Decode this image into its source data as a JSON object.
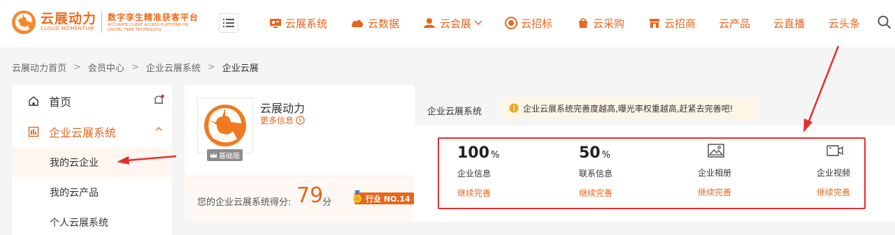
{
  "header": {
    "logo_cn": "云展动力",
    "logo_en": "CLOUD MOMENTUM",
    "slogan_cn": "数字孪生精准获客平台",
    "slogan_en": "ACCURATE CLIENT ACCESS PLATFORM ON DIGITAL TWIN TECHNOLOGY",
    "nav": [
      {
        "label": "云展系统",
        "icon": "exhibit-system-icon"
      },
      {
        "label": "云数据",
        "icon": "cloud-data-icon"
      },
      {
        "label": "云会展",
        "icon": "cloud-expo-icon"
      },
      {
        "label": "云招标",
        "icon": "cloud-bidding-icon"
      },
      {
        "label": "云采购",
        "icon": "cloud-purchase-icon"
      },
      {
        "label": "云招商",
        "icon": "cloud-investment-icon"
      },
      {
        "label": "云产品"
      },
      {
        "label": "云直播"
      },
      {
        "label": "云头条"
      }
    ],
    "accent": "#e8661a"
  },
  "breadcrumb": [
    "云展动力首页",
    "会员中心",
    "企业云展系统",
    "企业云展"
  ],
  "sidebar": {
    "home": "首页",
    "group": "企业云展系统",
    "items": [
      "我的云企业",
      "我的云产品",
      "个人云展系统"
    ],
    "active_index": 0
  },
  "profile": {
    "company_name": "云展动力",
    "more_info": "更多信息",
    "edition_badge": "基础版",
    "score_label": "您的企业云展系统得分:",
    "score": "79",
    "score_unit": "分",
    "rank": "行业 NO.14"
  },
  "panel": {
    "title": "企业云展系统",
    "notice": "企业云展系统完善度越高,曝光率权重越高,赶紧去完善吧!",
    "metrics": [
      {
        "value": "100",
        "unit": "%",
        "name": "企业信息",
        "action": "继续完善"
      },
      {
        "value": "50",
        "unit": "%",
        "name": "联系信息",
        "action": "继续完善"
      },
      {
        "name": "企业相册",
        "action": "继续完善",
        "icon": "image-icon"
      },
      {
        "name": "企业视频",
        "action": "继续完善",
        "icon": "video-icon"
      }
    ]
  },
  "colors": {
    "accent": "#e8661a",
    "highlight_box": "#e62e2e",
    "notice_bg": "#fdf6e6"
  }
}
